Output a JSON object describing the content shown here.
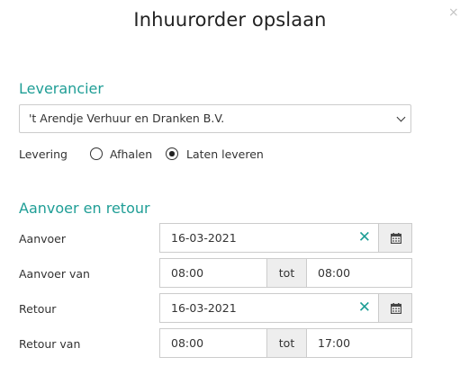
{
  "dialog": {
    "title": "Inhuurorder opslaan",
    "close_glyph": "×"
  },
  "supplier": {
    "section_title": "Leverancier",
    "selected": "'t Arendje Verhuur en Dranken B.V."
  },
  "delivery": {
    "label": "Levering",
    "options": [
      {
        "label": "Afhalen",
        "checked": false
      },
      {
        "label": "Laten leveren",
        "checked": true
      }
    ]
  },
  "schedule": {
    "section_title": "Aanvoer en retour",
    "rows": {
      "aanvoer": {
        "label": "Aanvoer",
        "date": "16-03-2021"
      },
      "aanvoer_van": {
        "label": "Aanvoer van",
        "from": "08:00",
        "sep": "tot",
        "to": "08:00"
      },
      "retour": {
        "label": "Retour",
        "date": "16-03-2021"
      },
      "retour_van": {
        "label": "Retour van",
        "from": "08:00",
        "sep": "tot",
        "to": "17:00"
      }
    }
  },
  "icons": {
    "clear": "clear-icon",
    "calendar": "calendar-icon",
    "close": "close-icon",
    "chevron": "chevron-down-icon"
  },
  "colors": {
    "accent": "#1f9e96",
    "addon_bg": "#eeeeee",
    "border": "#cccccc"
  }
}
